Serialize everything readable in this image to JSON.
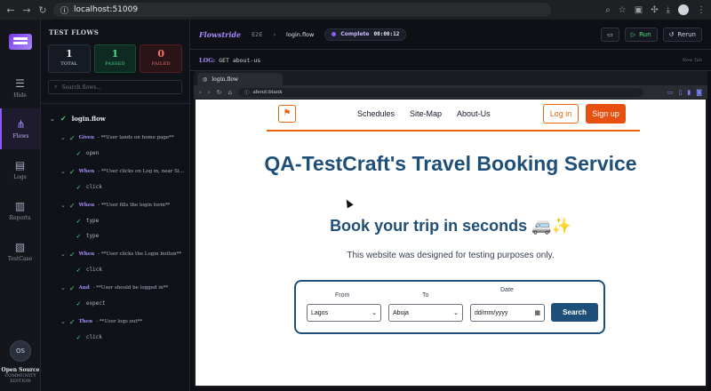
{
  "browser": {
    "url": "localhost:51009"
  },
  "rail": {
    "items": [
      {
        "label": "Hide",
        "icon": "list-icon"
      },
      {
        "label": "Flows",
        "icon": "flow-icon"
      },
      {
        "label": "Logs",
        "icon": "document-icon"
      },
      {
        "label": "Reports",
        "icon": "report-icon"
      },
      {
        "label": "TestCase",
        "icon": "clipboard-icon"
      }
    ],
    "badge": "OS",
    "edition_title": "Open Source",
    "edition_sub": "COMMUNITY EDITION"
  },
  "flows": {
    "heading": "TEST FLOWS",
    "stats": [
      {
        "value": "1",
        "label": "TOTAL"
      },
      {
        "value": "1",
        "label": "PASSED"
      },
      {
        "value": "0",
        "label": "FAILED"
      }
    ],
    "search_placeholder": "Search flows...",
    "root": "login.flow",
    "steps": [
      {
        "kw": "Given",
        "text": "- **User lands on home page**",
        "actions": [
          "open"
        ]
      },
      {
        "kw": "When",
        "text": "- **User clicks on Log in, near Si…",
        "actions": [
          "click"
        ]
      },
      {
        "kw": "When",
        "text": "- **User fills the login form**",
        "actions": [
          "type",
          "type"
        ]
      },
      {
        "kw": "When",
        "text": "- **User clicks the Login button**",
        "actions": [
          "click"
        ]
      },
      {
        "kw": "And",
        "text": "- **User should be logged in**",
        "actions": [
          "expect"
        ]
      },
      {
        "kw": "Then",
        "text": "- **User logs out**",
        "actions": [
          "click"
        ]
      }
    ]
  },
  "topbar": {
    "brand": "Flowstride",
    "crumb1": "E2E",
    "crumb2": "login.flow",
    "status": "Complete",
    "time": "00:00:12",
    "run": "Run",
    "rerun": "Rerun"
  },
  "log": {
    "label": "LOG:",
    "message": "GET about-us",
    "new_tab": "New Tab"
  },
  "inner": {
    "tab_title": "login.flow",
    "url": "about:blank"
  },
  "site": {
    "nav_links": [
      "Schedules",
      "Site-Map",
      "About-Us"
    ],
    "login": "Log in",
    "signup": "Sign up",
    "title": "QA-TestCraft's Travel Booking Service",
    "subtitle": "Book your trip in seconds 🚐✨",
    "description": "This website was designed for testing purposes only.",
    "from_label": "From",
    "to_label": "To",
    "date_label": "Date",
    "from_value": "Lagos",
    "to_value": "Abuja",
    "date_placeholder": "dd/mm/yyyy",
    "search": "Search"
  }
}
